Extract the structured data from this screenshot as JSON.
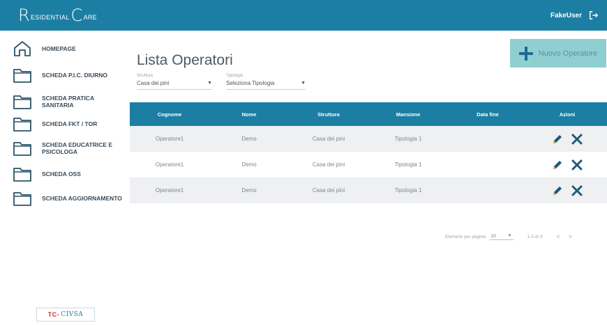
{
  "header": {
    "logo_r": "R",
    "logo_part1": "ESIDENTIAL",
    "logo_c": "C",
    "logo_part2": "ARE",
    "username": "FakeUser",
    "logout_icon": "logout-icon"
  },
  "sidebar": {
    "items": [
      {
        "label": "HOMEPAGE",
        "icon": "home-icon"
      },
      {
        "label": "SCHEDA P.I.C. DIURNO",
        "icon": "folder-icon"
      },
      {
        "label": "SCHEDA PRATICA SANITARIA",
        "icon": "folder-icon"
      },
      {
        "label": "SCHEDA FKT / TOR",
        "icon": "folder-icon"
      },
      {
        "label": "SCHEDA EDUCATRICE E PSICOLOGA",
        "icon": "folder-icon"
      },
      {
        "label": "SCHEDA OSS",
        "icon": "folder-icon"
      },
      {
        "label": "SCHEDA AGGIORNAMENTO",
        "icon": "folder-icon"
      }
    ],
    "partner_logo": {
      "part1": "TC-",
      "part2": "CIVSA"
    }
  },
  "main": {
    "title": "Lista Operatori",
    "add_button": "Nuovo Operatore",
    "filters": {
      "struttura": {
        "label": "Struttura",
        "value": "Casa dei pini"
      },
      "tipologia": {
        "label": "Tipologia",
        "value": "Seleziona Tipologia"
      }
    },
    "table": {
      "columns": [
        "Cognome",
        "Nome",
        "Struttura",
        "Mansione",
        "Data fine",
        "Azioni"
      ],
      "rows": [
        {
          "cognome": "Operatore1",
          "nome": "Demo",
          "struttura": "Casa dei pini",
          "mansione": "Tipologia 1",
          "data_fine": ""
        },
        {
          "cognome": "Operatore1",
          "nome": "Demo",
          "struttura": "Casa dei pini",
          "mansione": "Tipologia 1",
          "data_fine": ""
        },
        {
          "cognome": "Operatore1",
          "nome": "Demo",
          "struttura": "Casa dei pini",
          "mansione": "Tipologia 1",
          "data_fine": ""
        }
      ]
    },
    "pagination": {
      "items_per_page_label": "Elementi per pagina:",
      "items_per_page_value": "10",
      "range": "1-3 di 3",
      "prev": "<",
      "next": ">"
    }
  },
  "colors": {
    "primary": "#1c7ea3",
    "accent_button": "#8fcfd1",
    "row_alt": "#eef0f2",
    "action_icon": "#1c5a7a"
  }
}
